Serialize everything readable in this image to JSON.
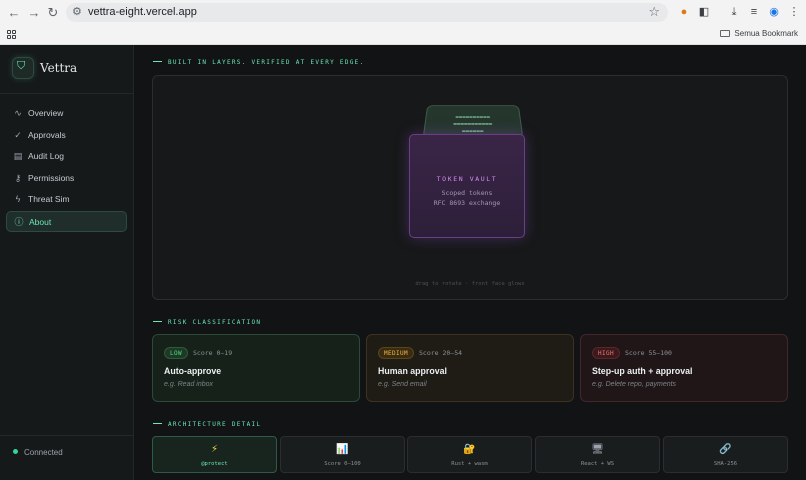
{
  "browser": {
    "url": "vettra-eight.vercel.app",
    "bookmark_label": "Semua Bookmark"
  },
  "sidebar": {
    "brand": "Vettra",
    "items": [
      {
        "label": "Overview",
        "icon": "activity-icon"
      },
      {
        "label": "Approvals",
        "icon": "check-circle-icon"
      },
      {
        "label": "Audit Log",
        "icon": "document-icon"
      },
      {
        "label": "Permissions",
        "icon": "key-icon"
      },
      {
        "label": "Threat Sim",
        "icon": "lightning-icon"
      },
      {
        "label": "About",
        "icon": "info-icon",
        "active": true
      }
    ],
    "status": "Connected"
  },
  "main": {
    "layers_label": "BUILT IN LAYERS. VERIFIED AT EVERY EDGE.",
    "cube": {
      "front_title": "TOKEN VAULT",
      "front_line1": "Scoped tokens",
      "front_line2": "RFC 8693 exchange",
      "hint": "drag to rotate · front face glows"
    },
    "risk_label": "RISK CLASSIFICATION",
    "risk_cards": [
      {
        "badge": "LOW",
        "score": "Score 0–19",
        "title": "Auto-approve",
        "example": "e.g. Read inbox",
        "color": "#4ade80"
      },
      {
        "badge": "MEDIUM",
        "score": "Score 20–54",
        "title": "Human approval",
        "example": "e.g. Send email",
        "color": "#f59e0b"
      },
      {
        "badge": "HIGH",
        "score": "Score 55–100",
        "title": "Step-up auth + approval",
        "example": "e.g. Delete repo, payments",
        "color": "#ef4444"
      }
    ],
    "arch_label": "ARCHITECTURE DETAIL",
    "arch_tiles": [
      {
        "icon": "⚡",
        "label": "@protect",
        "active": true
      },
      {
        "icon": "📊",
        "label": "Score 0–100"
      },
      {
        "icon": "🔐",
        "label": "Rust + wasm"
      },
      {
        "icon": "🖥",
        "label": "React + WS"
      },
      {
        "icon": "🔗",
        "label": "SHA-256"
      }
    ]
  }
}
